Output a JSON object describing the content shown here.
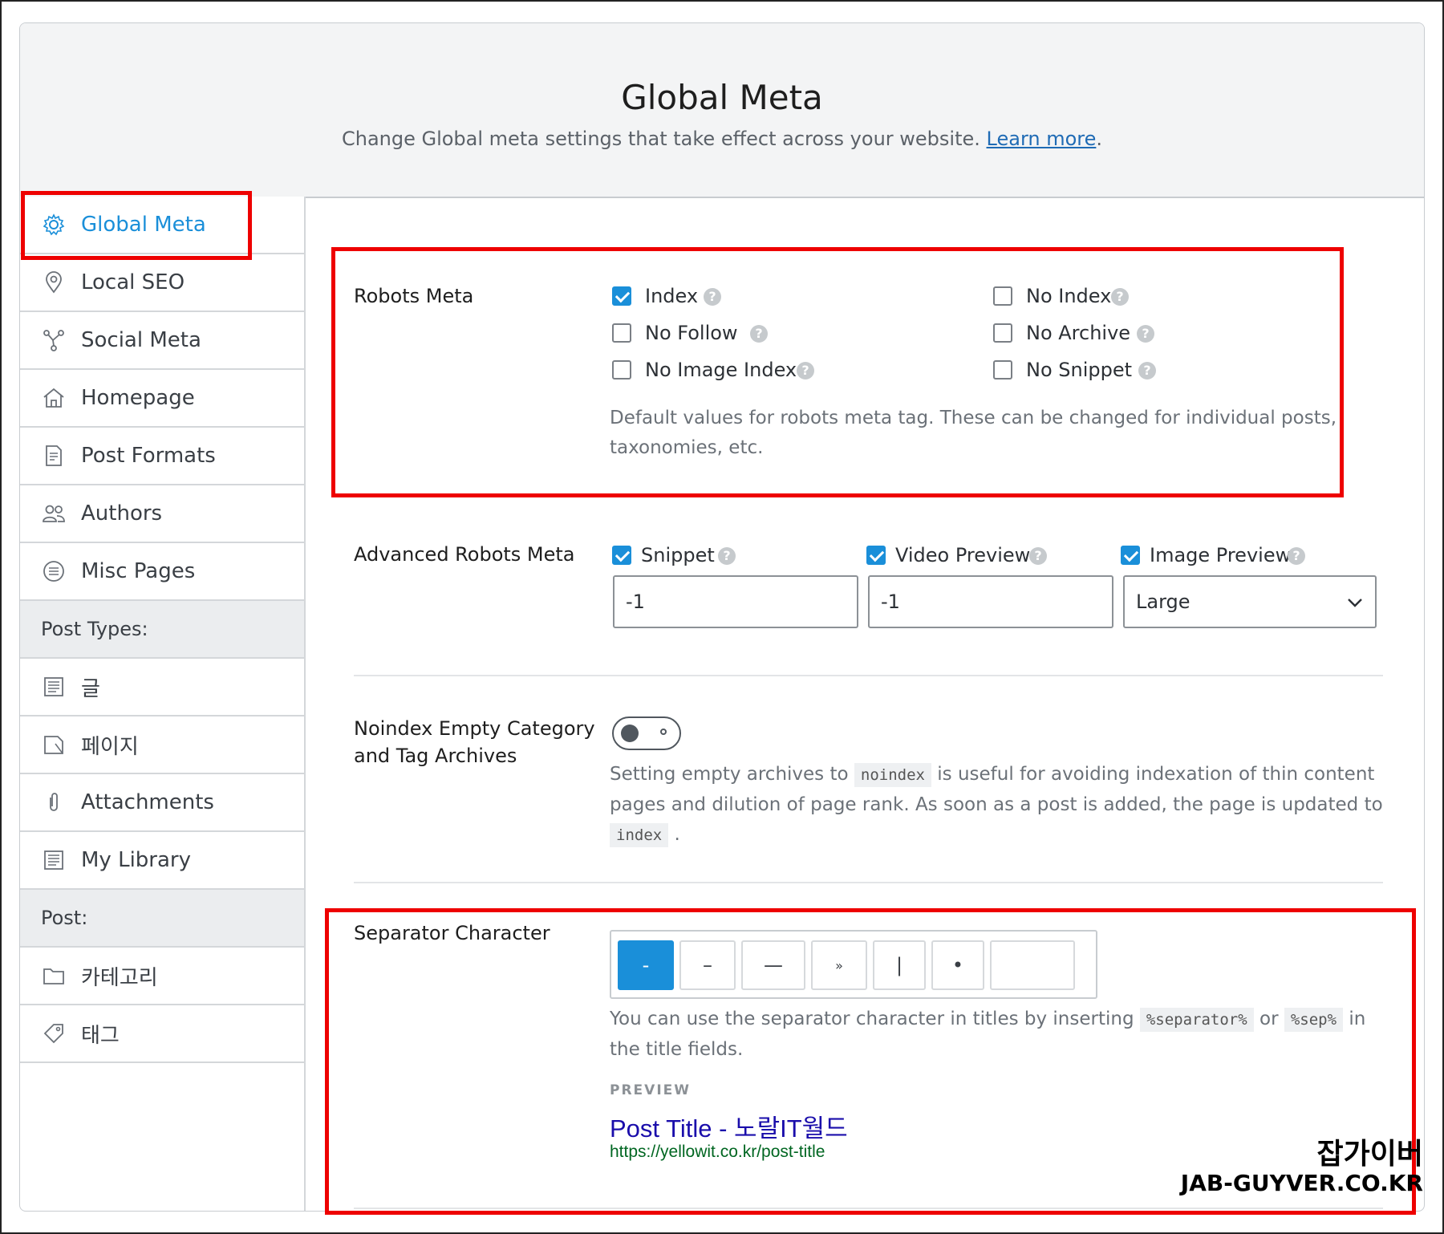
{
  "header": {
    "title": "Global Meta",
    "subtitle": "Change Global meta settings that take effect across your website. ",
    "learn_more": "Learn more",
    "period": "."
  },
  "sidebar": {
    "items": [
      {
        "label": "Global Meta",
        "icon": "gear-icon"
      },
      {
        "label": "Local SEO",
        "icon": "map-pin-icon"
      },
      {
        "label": "Social Meta",
        "icon": "share-network-icon"
      },
      {
        "label": "Homepage",
        "icon": "home-icon"
      },
      {
        "label": "Post Formats",
        "icon": "document-icon"
      },
      {
        "label": "Authors",
        "icon": "users-icon"
      },
      {
        "label": "Misc Pages",
        "icon": "list-circle-icon"
      }
    ],
    "post_types_heading": "Post Types:",
    "post_types": [
      {
        "label": "글",
        "icon": "post-icon"
      },
      {
        "label": "페이지",
        "icon": "page-icon"
      },
      {
        "label": "Attachments",
        "icon": "paperclip-icon"
      },
      {
        "label": "My Library",
        "icon": "library-icon"
      }
    ],
    "post_heading": "Post:",
    "post_taxonomies": [
      {
        "label": "카테고리",
        "icon": "folder-icon"
      },
      {
        "label": "태그",
        "icon": "tag-icon"
      }
    ]
  },
  "robots_meta": {
    "label": "Robots Meta",
    "options": [
      {
        "label": "Index",
        "checked": true
      },
      {
        "label": "No Index",
        "checked": false
      },
      {
        "label": "No Follow",
        "checked": false
      },
      {
        "label": "No Archive",
        "checked": false
      },
      {
        "label": "No Image Index",
        "checked": false
      },
      {
        "label": "No Snippet",
        "checked": false
      }
    ],
    "description": "Default values for robots meta tag. These can be changed for individual posts, taxonomies, etc."
  },
  "advanced_robots": {
    "label": "Advanced Robots Meta",
    "snippet": {
      "label": "Snippet",
      "checked": true,
      "value": "-1"
    },
    "video_preview": {
      "label": "Video Preview",
      "checked": true,
      "value": "-1"
    },
    "image_preview": {
      "label": "Image Preview",
      "checked": true,
      "value": "Large"
    }
  },
  "noindex_empty": {
    "label_line1": "Noindex Empty Category",
    "label_line2": "and Tag Archives",
    "enabled": false,
    "desc_part1": "Setting empty archives to ",
    "code1": "noindex",
    "desc_part2": " is useful for avoiding indexation of thin content pages and dilution of page rank. As soon as a post is added, the page is updated to ",
    "code2": "index",
    "desc_part3": " ."
  },
  "separator": {
    "label": "Separator Character",
    "options": [
      "-",
      "–",
      "—",
      "»",
      "|",
      "•",
      ""
    ],
    "selected_index": 0,
    "desc_part1": "You can use the separator character in titles by inserting ",
    "code1": "%separator%",
    "desc_or": " or ",
    "code2": "%sep%",
    "desc_part2": " in the title fields.",
    "preview_heading": "PREVIEW",
    "preview_title": "Post Title - 노랄IT월드",
    "preview_url": "https://yellowit.co.kr/post-title"
  },
  "watermark": {
    "line1": "잡가이버",
    "line2": "JAB-GUYVER.CO.KR"
  },
  "colors": {
    "accent": "#1a8fd9",
    "highlight_box": "#ee0000",
    "preview_title": "#1a0dab",
    "preview_url": "#006621"
  }
}
